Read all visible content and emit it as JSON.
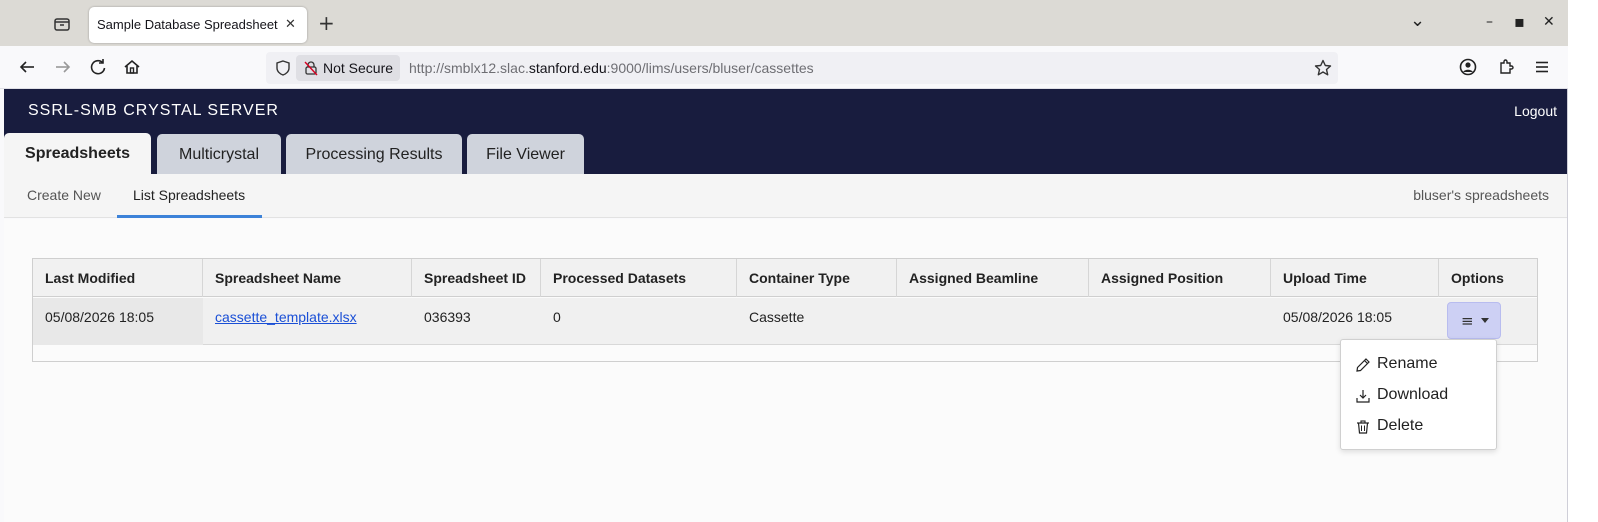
{
  "browser": {
    "tab_title": "Sample Database Spreadsheet",
    "tab_close": "✕",
    "new_tab": "+",
    "not_secure": "Not Secure",
    "url_prefix": "http://smblx12.slac.",
    "url_host": "stanford.edu",
    "url_suffix": ":9000/lims/users/bluser/cassettes",
    "win_chevron": "⌄",
    "win_min": "–",
    "win_max": "▪",
    "win_close": "✕"
  },
  "app": {
    "title": "SSRL-SMB CRYSTAL SERVER",
    "logout": "Logout",
    "tabs": [
      {
        "label": "Spreadsheets"
      },
      {
        "label": "Multicrystal"
      },
      {
        "label": "Processing Results"
      },
      {
        "label": "File Viewer"
      }
    ],
    "subnav": {
      "items": [
        {
          "label": "Create New"
        },
        {
          "label": "List Spreadsheets"
        }
      ],
      "right": "bluser's spreadsheets"
    }
  },
  "table": {
    "headers": [
      "Last Modified",
      "Spreadsheet Name",
      "Spreadsheet ID",
      "Processed Datasets",
      "Container Type",
      "Assigned Beamline",
      "Assigned Position",
      "Upload Time",
      "Options"
    ],
    "rows": [
      {
        "last_modified": "05/08/2026 18:05",
        "name": "cassette_template.xlsx",
        "id": "036393",
        "processed": "0",
        "container": "Cassette",
        "beamline": "",
        "position": "",
        "upload_time": "05/08/2026 18:05"
      }
    ],
    "options_icon": "≡"
  },
  "menu": {
    "items": [
      {
        "label": "Rename",
        "icon": "pencil-icon"
      },
      {
        "label": "Download",
        "icon": "download-icon"
      },
      {
        "label": "Delete",
        "icon": "trash-icon"
      }
    ]
  },
  "colors": {
    "header_bg": "#181c3e",
    "link": "#1a4fd6",
    "accent": "#3c82d8",
    "options_button": "#cdd0f4"
  }
}
